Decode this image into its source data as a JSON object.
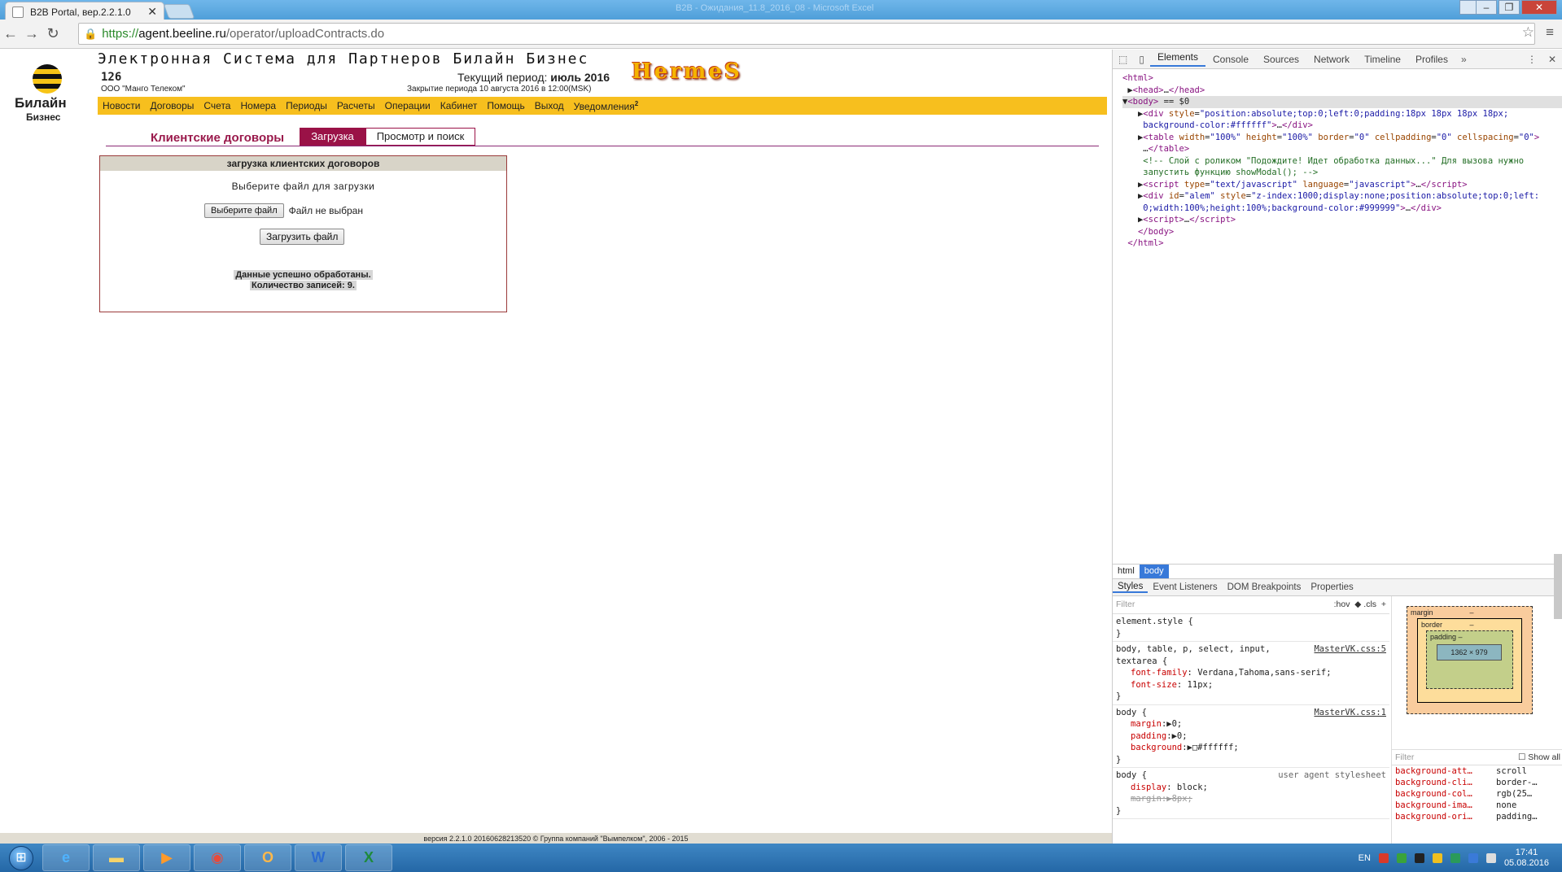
{
  "browser": {
    "tab_title": "B2B Portal, вер.2.2.1.0",
    "window_title": "B2B - Ожидания_11.8_2016_08 - Microsoft Excel",
    "url_scheme": "https://",
    "url_host": "agent.beeline.ru",
    "url_path": "/operator/uploadContracts.do"
  },
  "header": {
    "logo_text": "Билайн",
    "logo_sub": "Бизнес",
    "system_title": "Электронная Система для Партнеров Билайн Бизнес",
    "account_number": "126",
    "company": "ООО \"Манго Телеком\"",
    "period_label": "Текущий период:",
    "period_value": "июль 2016",
    "closing_text": "Закрытие периода 10 августа 2016 в 12:00(MSK)",
    "brand": "HermeS"
  },
  "nav": {
    "items": [
      "Новости",
      "Договоры",
      "Счета",
      "Номера",
      "Периоды",
      "Расчеты",
      "Операции",
      "Кабинет",
      "Помощь",
      "Выход"
    ],
    "notifications_label": "Уведомления",
    "notifications_count": "2"
  },
  "subnav": {
    "section_title": "Клиентские договоры",
    "tab_upload": "Загрузка",
    "tab_search": "Просмотр и поиск"
  },
  "upload_panel": {
    "title": "загрузка клиентских договоров",
    "prompt": "Выберите файл для загрузки",
    "choose_button": "Выберите файл",
    "no_file": "Файл не выбран",
    "upload_button": "Загрузить файл",
    "result_line1": "Данные успешно обработаны.",
    "result_line2": "Количество записей: 9."
  },
  "footer": {
    "text": "версия 2.2.1.0 20160628213520 © Группа компаний \"Вымпелком\", 2006 - 2015"
  },
  "devtools": {
    "tabs": [
      "Elements",
      "Console",
      "Sources",
      "Network",
      "Timeline",
      "Profiles"
    ],
    "crumbs": [
      "html",
      "body"
    ],
    "style_tabs": [
      "Styles",
      "Event Listeners",
      "DOM Breakpoints",
      "Properties"
    ],
    "filter_placeholder": "Filter",
    "hov": ":hov",
    "cls": ".cls",
    "box_content": "1362 × 979",
    "show_all": "Show all",
    "computed": [
      {
        "k": "background-att…",
        "v": "scroll"
      },
      {
        "k": "background-cli…",
        "v": "border-…"
      },
      {
        "k": "background-col…",
        "v": "rgb(25…"
      },
      {
        "k": "background-ima…",
        "v": "none"
      },
      {
        "k": "background-ori…",
        "v": "padding…"
      }
    ],
    "css_file_1": "MasterVK.css:5",
    "css_file_2": "MasterVK.css:1",
    "ua_stylesheet": "user agent stylesheet"
  },
  "taskbar": {
    "lang": "EN",
    "time": "17:41",
    "date": "05.08.2016"
  }
}
